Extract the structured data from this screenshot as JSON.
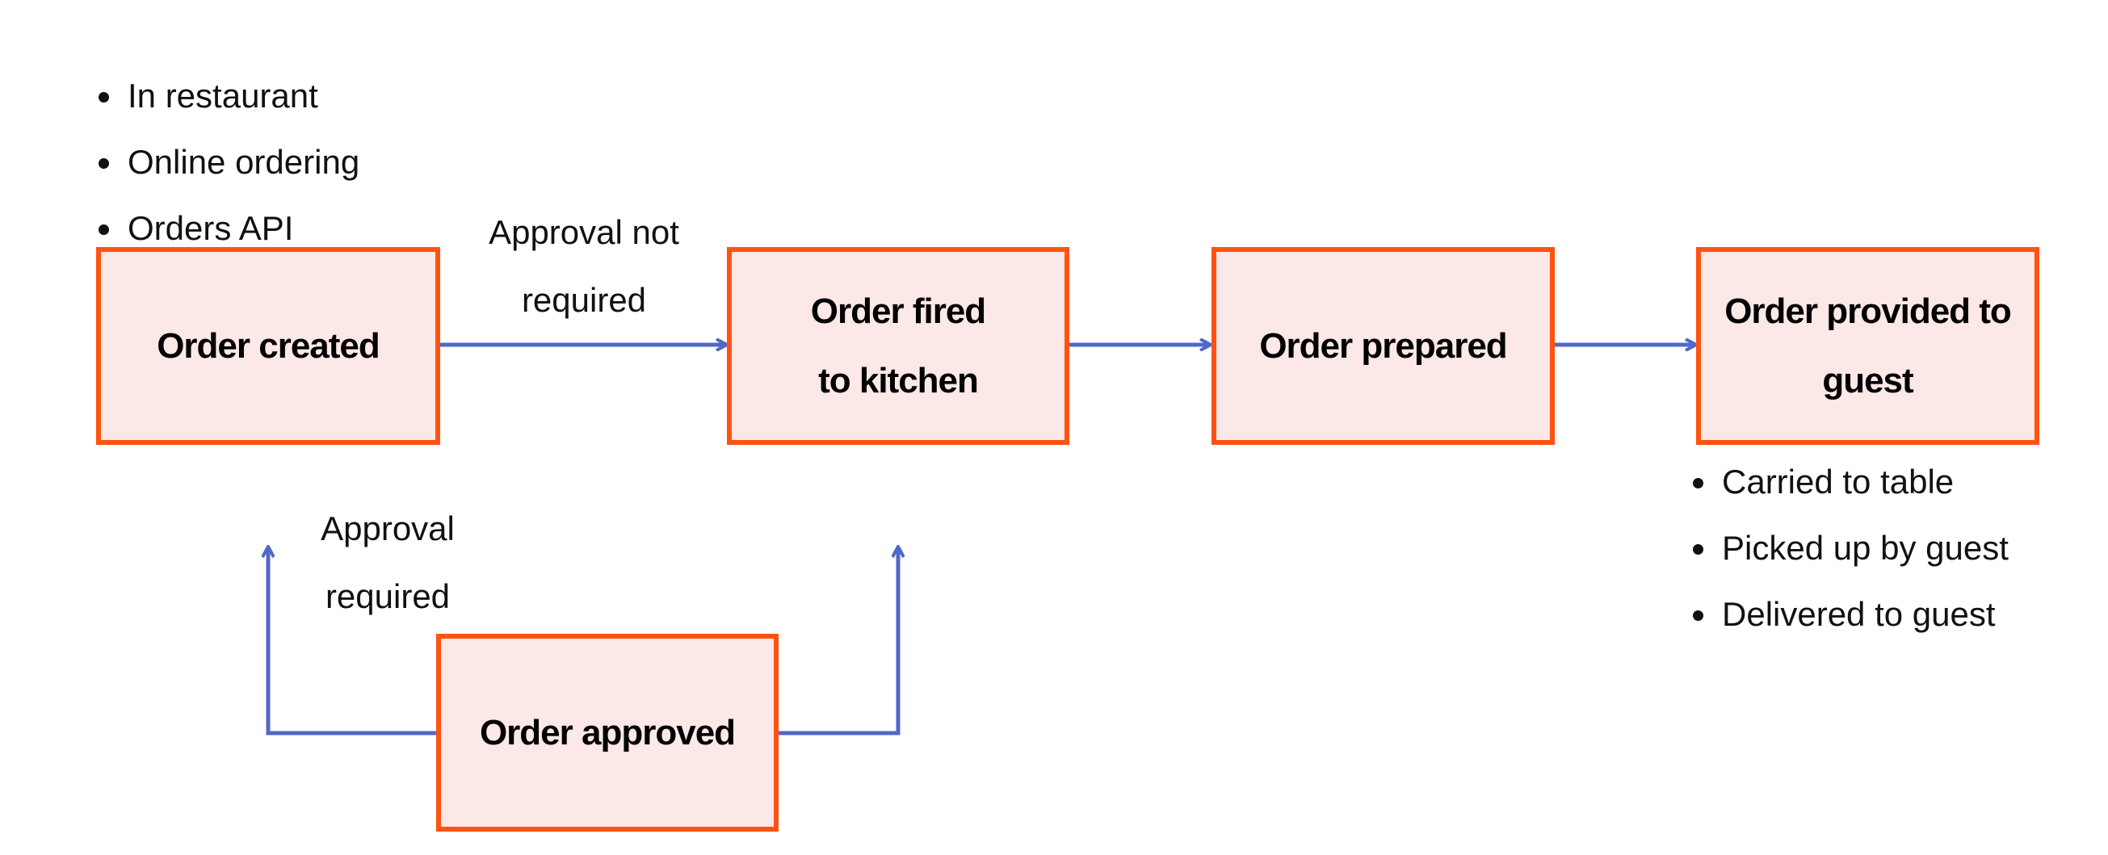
{
  "colors": {
    "box_border": "#FF5212",
    "box_fill": "#FCE8E6",
    "arrow": "#5068C8"
  },
  "nodes": {
    "created": "Order created",
    "fired": "Order fired to kitchen",
    "prepared": "Order prepared",
    "provided": "Order provided to guest",
    "approved": "Order approved"
  },
  "edges": {
    "not_required": "Approval not required",
    "required": "Approval required"
  },
  "sources": [
    "In restaurant",
    "Online ordering",
    "Orders API"
  ],
  "delivery": [
    "Carried to table",
    "Picked up by guest",
    "Delivered to guest"
  ]
}
